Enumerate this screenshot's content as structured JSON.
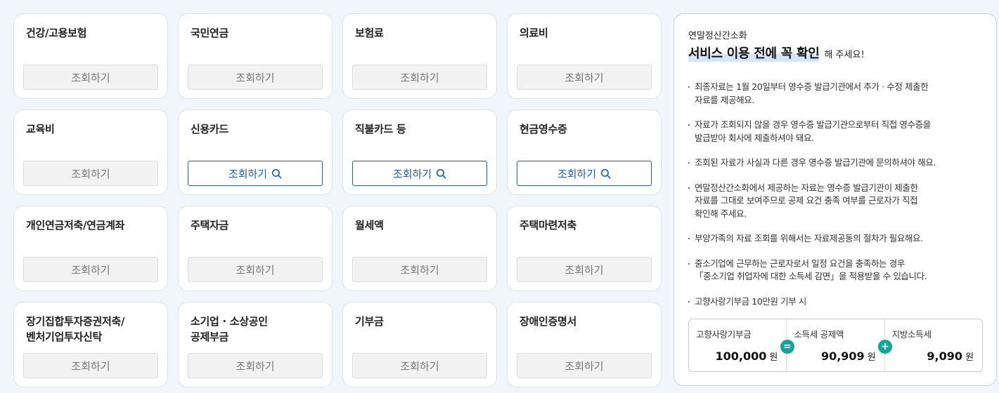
{
  "cards": [
    {
      "title": "건강/고용보험",
      "button": "조회하기",
      "active": false
    },
    {
      "title": "국민연금",
      "button": "조회하기",
      "active": false
    },
    {
      "title": "보험료",
      "button": "조회하기",
      "active": false
    },
    {
      "title": "의료비",
      "button": "조회하기",
      "active": false
    },
    {
      "title": "교육비",
      "button": "조회하기",
      "active": false
    },
    {
      "title": "신용카드",
      "button": "조회하기",
      "active": true
    },
    {
      "title": "직불카드 등",
      "button": "조회하기",
      "active": true
    },
    {
      "title": "현금영수증",
      "button": "조회하기",
      "active": true
    },
    {
      "title": "개인연금저축/연금계좌",
      "button": "조회하기",
      "active": false
    },
    {
      "title": "주택자금",
      "button": "조회하기",
      "active": false
    },
    {
      "title": "월세액",
      "button": "조회하기",
      "active": false
    },
    {
      "title": "주택마련저축",
      "button": "조회하기",
      "active": false
    },
    {
      "title": "장기집합투자증권저축/\n벤처기업투자신탁",
      "button": "조회하기",
      "active": false
    },
    {
      "title": "소기업 · 소상공인\n공제부금",
      "button": "조회하기",
      "active": false
    },
    {
      "title": "기부금",
      "button": "조회하기",
      "active": false
    },
    {
      "title": "장애인증명서",
      "button": "조회하기",
      "active": false
    }
  ],
  "side": {
    "subtitle": "연말정산간소화",
    "headline": "서비스 이용 전에 꼭 확인",
    "headline_suffix": "해 주세요!",
    "notes": [
      "최종자료는 1월 20일부터 영수증 발급기관에서 추가 · 수정 제출한\n자료를 제공해요.",
      "자료가 조회되지 않을 경우 영수증 발급기관으로부터 직접 영수증을\n발급받아 회사에 제출하셔야 돼요.",
      "조회된 자료가 사실과 다른 경우 영수증 발급기관에 문의하셔야 해요.",
      "연말정산간소화에서 제공하는 자료는 영수증 발급기관이 제출한\n자료를 그대로 보여주므로 공제 요건 충족 여부를 근로자가 직접\n확인해 주세요.",
      "부양가족의 자료 조회를 위해서는 자료제공동의 절차가 필요해요.",
      "중소기업에 근무하는 근로자로서 일정 요건을 충족하는 경우\n「중소기업 취업자에 대한 소득세 감면」을 적용받을 수 있습니다.",
      "고향사랑기부금 10만원 기부 시"
    ],
    "calc": {
      "items": [
        {
          "label": "고향사랑기부금",
          "value": "100,000",
          "unit": "원"
        },
        {
          "label": "소득세 공제액",
          "value": "90,909",
          "unit": "원"
        },
        {
          "label": "지방소득세",
          "value": "9,090",
          "unit": "원"
        }
      ],
      "operators": [
        "=",
        "+"
      ],
      "operator_color": "#16a39a"
    }
  },
  "colors": {
    "accent": "#1f5fb8",
    "background": "#f1f5fc"
  }
}
